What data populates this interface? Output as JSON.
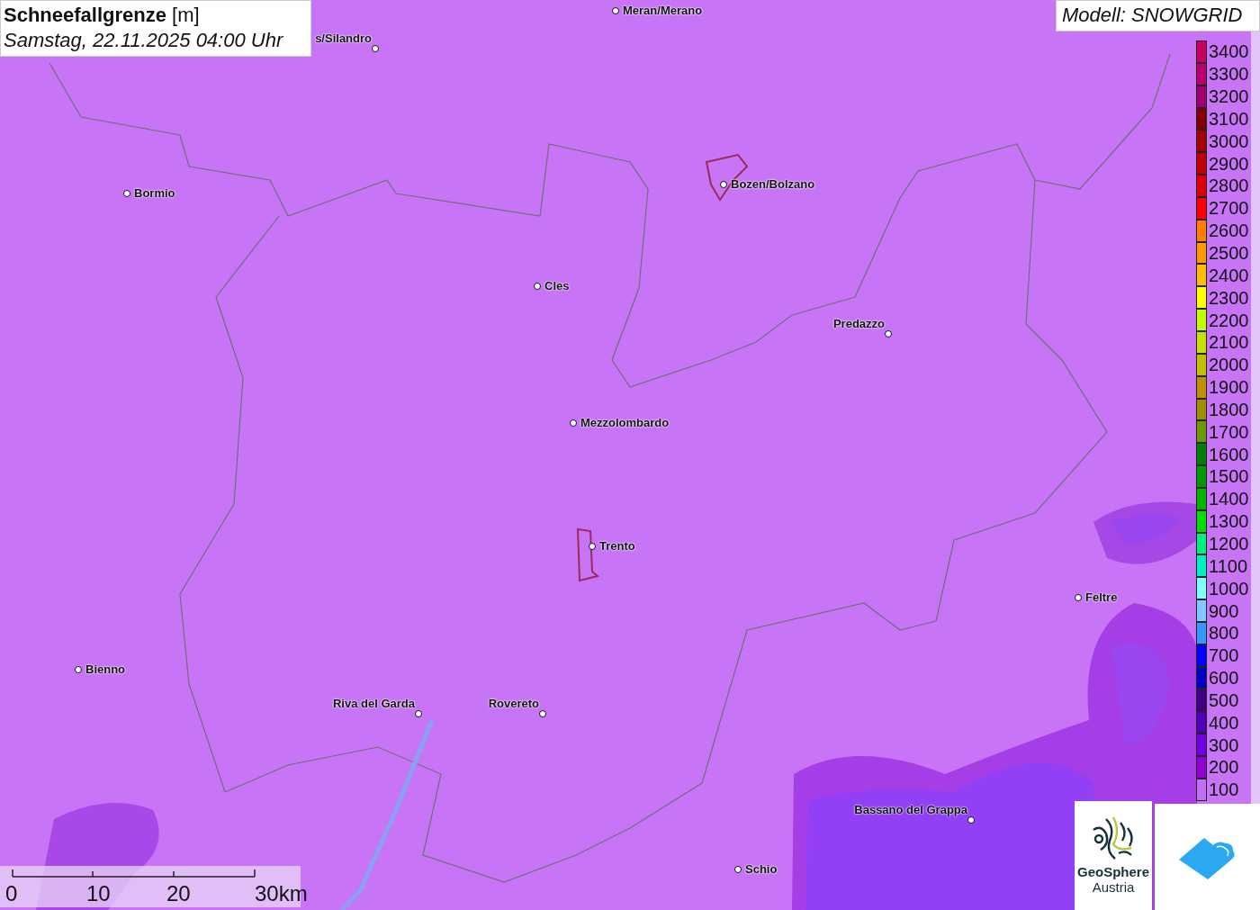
{
  "title": {
    "heading": "**Schneefallgrenze** [m]",
    "subtitle": "Samstag, 22.11.2025 04:00 Uhr"
  },
  "model": "Modell: SNOWGRID",
  "cities": [
    {
      "name": "Meran/Merano"
    },
    {
      "name": "s/Silandro"
    },
    {
      "name": "Bormio"
    },
    {
      "name": "Bozen/Bolzano"
    },
    {
      "name": "Cles"
    },
    {
      "name": "Predazzo"
    },
    {
      "name": "Mezzolombardo"
    },
    {
      "name": "Trento"
    },
    {
      "name": "Feltre"
    },
    {
      "name": "Bienno"
    },
    {
      "name": "Riva del Garda"
    },
    {
      "name": "Rovereto"
    },
    {
      "name": "Bassano del Grappa"
    },
    {
      "name": "Schio"
    }
  ],
  "legend": [
    {
      "label": "3400",
      "color": "#c8005e"
    },
    {
      "label": "3300",
      "color": "#b8006c"
    },
    {
      "label": "3200",
      "color": "#a0006e"
    },
    {
      "label": "3100",
      "color": "#800000"
    },
    {
      "label": "3000",
      "color": "#a50000"
    },
    {
      "label": "2900",
      "color": "#c00000"
    },
    {
      "label": "2800",
      "color": "#dd0000"
    },
    {
      "label": "2700",
      "color": "#ff0000"
    },
    {
      "label": "2600",
      "color": "#ff7f00"
    },
    {
      "label": "2500",
      "color": "#ff9900"
    },
    {
      "label": "2400",
      "color": "#ffbf00"
    },
    {
      "label": "2300",
      "color": "#ffff00"
    },
    {
      "label": "2200",
      "color": "#bfff00"
    },
    {
      "label": "2100",
      "color": "#c8e000"
    },
    {
      "label": "2000",
      "color": "#c0c000"
    },
    {
      "label": "1900",
      "color": "#c09000"
    },
    {
      "label": "1800",
      "color": "#a09000"
    },
    {
      "label": "1700",
      "color": "#6a9a00"
    },
    {
      "label": "1600",
      "color": "#007f00"
    },
    {
      "label": "1500",
      "color": "#009900"
    },
    {
      "label": "1400",
      "color": "#00b400"
    },
    {
      "label": "1300",
      "color": "#00e000"
    },
    {
      "label": "1200",
      "color": "#00f080"
    },
    {
      "label": "1100",
      "color": "#00f0c0"
    },
    {
      "label": "1000",
      "color": "#80ffff"
    },
    {
      "label": "900",
      "color": "#80c8ff"
    },
    {
      "label": "800",
      "color": "#3399ff"
    },
    {
      "label": "700",
      "color": "#0000ff"
    },
    {
      "label": "600",
      "color": "#0000c0"
    },
    {
      "label": "500",
      "color": "#400080"
    },
    {
      "label": "400",
      "color": "#5000b0"
    },
    {
      "label": "300",
      "color": "#7000e0"
    },
    {
      "label": "200",
      "color": "#9000d0"
    },
    {
      "label": "100",
      "color": "#c070f0"
    }
  ],
  "scale": {
    "labels": [
      "0",
      "10",
      "20",
      "30km"
    ]
  },
  "logo": {
    "name": "GeoSphere",
    "sub": "Austria"
  }
}
